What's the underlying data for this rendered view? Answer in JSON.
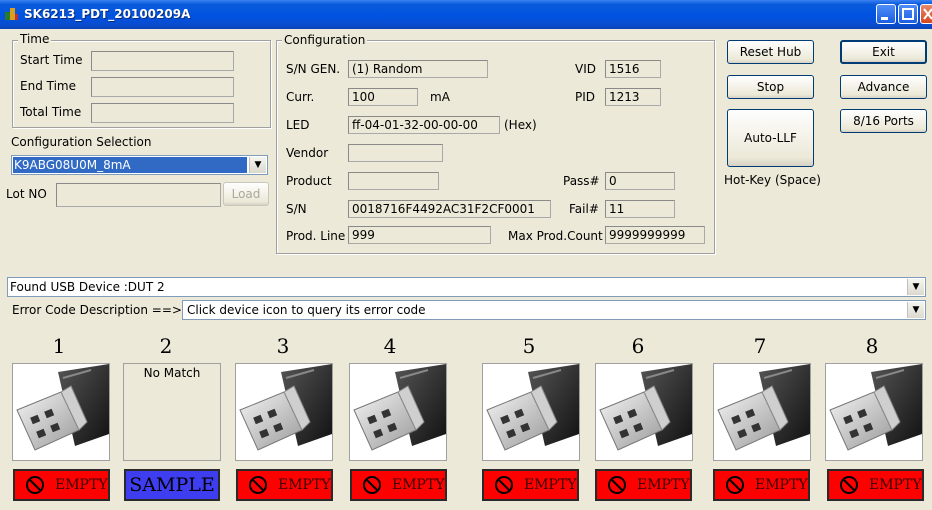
{
  "window": {
    "title": "SK6213_PDT_20100209A"
  },
  "time": {
    "legend": "Time",
    "start_label": "Start Time",
    "start_value": "",
    "end_label": "End Time",
    "end_value": "",
    "total_label": "Total Time",
    "total_value": ""
  },
  "config_selection": {
    "label": "Configuration Selection",
    "value": "K9ABG08U0M_8mA"
  },
  "lot": {
    "label": "Lot NO",
    "value": "",
    "load_label": "Load"
  },
  "configuration": {
    "legend": "Configuration",
    "sn_gen_label": "S/N GEN.",
    "sn_gen_value": "(1) Random",
    "curr_label": "Curr.",
    "curr_value": "100",
    "curr_unit": "mA",
    "led_label": "LED",
    "led_value": "ff-04-01-32-00-00-00",
    "led_unit": "(Hex)",
    "vendor_label": "Vendor",
    "vendor_value": "",
    "product_label": "Product",
    "product_value": "",
    "sn_label": "S/N",
    "sn_value": "0018716F4492AC31F2CF0001",
    "prodline_label": "Prod. Line",
    "prodline_value": "999",
    "vid_label": "VID",
    "vid_value": "1516",
    "pid_label": "PID",
    "pid_value": "1213",
    "pass_label": "Pass#",
    "pass_value": "0",
    "fail_label": "Fail#",
    "fail_value": "11",
    "maxprod_label": "Max Prod.Count",
    "maxprod_value": "9999999999"
  },
  "buttons": {
    "reset_hub": "Reset Hub",
    "stop": "Stop",
    "auto_llf": "Auto-LLF",
    "hotkey": "Hot-Key (Space)",
    "exit": "Exit",
    "advance": "Advance",
    "ports": "8/16 Ports"
  },
  "device_status": {
    "value": "Found USB Device :DUT 2"
  },
  "error_code": {
    "label": "Error Code Description ==>",
    "value": "Click device icon to query its error code"
  },
  "ports": [
    {
      "num": "1",
      "state": "usb",
      "status": "EMPTY"
    },
    {
      "num": "2",
      "state": "nomatch",
      "text": "No Match",
      "status": "SAMPLE"
    },
    {
      "num": "3",
      "state": "usb",
      "status": "EMPTY"
    },
    {
      "num": "4",
      "state": "usb",
      "status": "EMPTY"
    },
    {
      "num": "5",
      "state": "usb",
      "status": "EMPTY"
    },
    {
      "num": "6",
      "state": "usb",
      "status": "EMPTY"
    },
    {
      "num": "7",
      "state": "usb",
      "status": "EMPTY"
    },
    {
      "num": "8",
      "state": "usb",
      "status": "EMPTY"
    }
  ],
  "colors": {
    "titlebar": "#0053e1",
    "empty": "#ff0000",
    "sample": "#3e3ef0",
    "selection": "#316ac5"
  }
}
